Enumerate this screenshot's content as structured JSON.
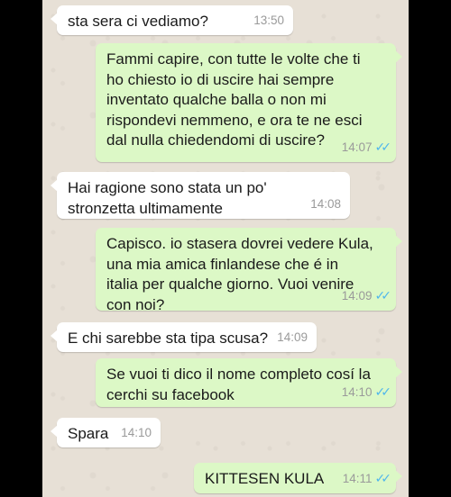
{
  "messages": [
    {
      "direction": "in",
      "text": "sta sera ci vediamo?",
      "time": "13:50",
      "ticks": ""
    },
    {
      "direction": "out",
      "text": "Fammi capire, con tutte le volte che ti\nho chiesto io di uscire hai sempre\ninventato qualche balla o non mi\nrispondevi nemmeno, e ora te ne esci\ndal nulla chiedendomi di uscire?",
      "time": "14:07",
      "ticks": "✓✓"
    },
    {
      "direction": "in",
      "text": "Hai ragione sono stata un po'\nstronzetta ultimamente",
      "time": "14:08",
      "ticks": ""
    },
    {
      "direction": "out",
      "text": "Capisco. io stasera dovrei vedere Kula,\nuna mia amica finlandese che é in\nitalia per qualche giorno. Vuoi venire\ncon noi?",
      "time": "14:09",
      "ticks": "✓✓"
    },
    {
      "direction": "in",
      "text": "E chi sarebbe sta tipa scusa?",
      "time": "14:09",
      "ticks": ""
    },
    {
      "direction": "out",
      "text": "Se vuoi ti dico il nome completo cosí la\ncerchi su facebook",
      "time": "14:10",
      "ticks": "✓✓"
    },
    {
      "direction": "in",
      "text": "Spara",
      "time": "14:10",
      "ticks": ""
    },
    {
      "direction": "out",
      "text": "KITTESEN KULA",
      "time": "14:11",
      "ticks": "✓✓"
    }
  ],
  "colors": {
    "chat_background": "#e7e0d6",
    "incoming_bubble": "#ffffff",
    "outgoing_bubble": "#dcf8c6",
    "read_ticks": "#4fb6ec",
    "timestamp": "#9a9a9a"
  }
}
